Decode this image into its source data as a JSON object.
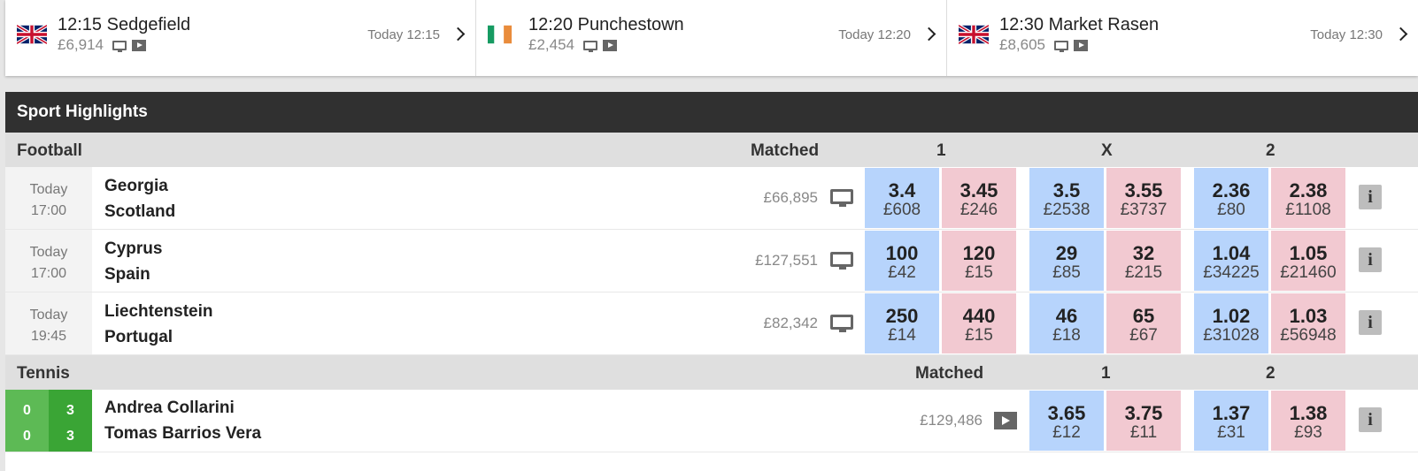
{
  "races": [
    {
      "title": "12:15 Sedgefield",
      "prize": "£6,914",
      "time": "Today 12:15",
      "flag": "uk-flag"
    },
    {
      "title": "12:20 Punchestown",
      "prize": "£2,454",
      "time": "Today 12:20",
      "flag": "ireland-flag"
    },
    {
      "title": "12:30 Market Rasen",
      "prize": "£8,605",
      "time": "Today 12:30",
      "flag": "uk-flag"
    }
  ],
  "highlights": {
    "title": "Sport Highlights",
    "football": {
      "label": "Football",
      "matched_label": "Matched",
      "col1": "1",
      "colx": "X",
      "col2": "2",
      "rows": [
        {
          "day": "Today",
          "time": "17:00",
          "home": "Georgia",
          "away": "Scotland",
          "matched": "£66,895",
          "odds": [
            [
              "3.4",
              "£608"
            ],
            [
              "3.45",
              "£246"
            ],
            [
              "3.5",
              "£2538"
            ],
            [
              "3.55",
              "£3737"
            ],
            [
              "2.36",
              "£80"
            ],
            [
              "2.38",
              "£1108"
            ]
          ]
        },
        {
          "day": "Today",
          "time": "17:00",
          "home": "Cyprus",
          "away": "Spain",
          "matched": "£127,551",
          "odds": [
            [
              "100",
              "£42"
            ],
            [
              "120",
              "£15"
            ],
            [
              "29",
              "£85"
            ],
            [
              "32",
              "£215"
            ],
            [
              "1.04",
              "£34225"
            ],
            [
              "1.05",
              "£21460"
            ]
          ]
        },
        {
          "day": "Today",
          "time": "19:45",
          "home": "Liechtenstein",
          "away": "Portugal",
          "matched": "£82,342",
          "odds": [
            [
              "250",
              "£14"
            ],
            [
              "440",
              "£15"
            ],
            [
              "46",
              "£18"
            ],
            [
              "65",
              "£67"
            ],
            [
              "1.02",
              "£31028"
            ],
            [
              "1.03",
              "£56948"
            ]
          ]
        }
      ]
    },
    "tennis": {
      "label": "Tennis",
      "matched_label": "Matched",
      "col1": "1",
      "col2": "2",
      "rows": [
        {
          "set_p1": "0",
          "set_p2": "0",
          "game_p1": "3",
          "game_p2": "3",
          "player1": "Andrea Collarini",
          "player2": "Tomas Barrios Vera",
          "matched": "£129,486",
          "odds": [
            [
              "3.65",
              "£12"
            ],
            [
              "3.75",
              "£11"
            ],
            [
              "1.37",
              "£31"
            ],
            [
              "1.38",
              "£93"
            ]
          ]
        }
      ]
    },
    "info_label": "i"
  },
  "colors": {
    "back": "#b7d4fc",
    "lay": "#f2c9d1",
    "header": "#303030",
    "score_dark": "#3aa535",
    "score_light": "#5dba55"
  }
}
